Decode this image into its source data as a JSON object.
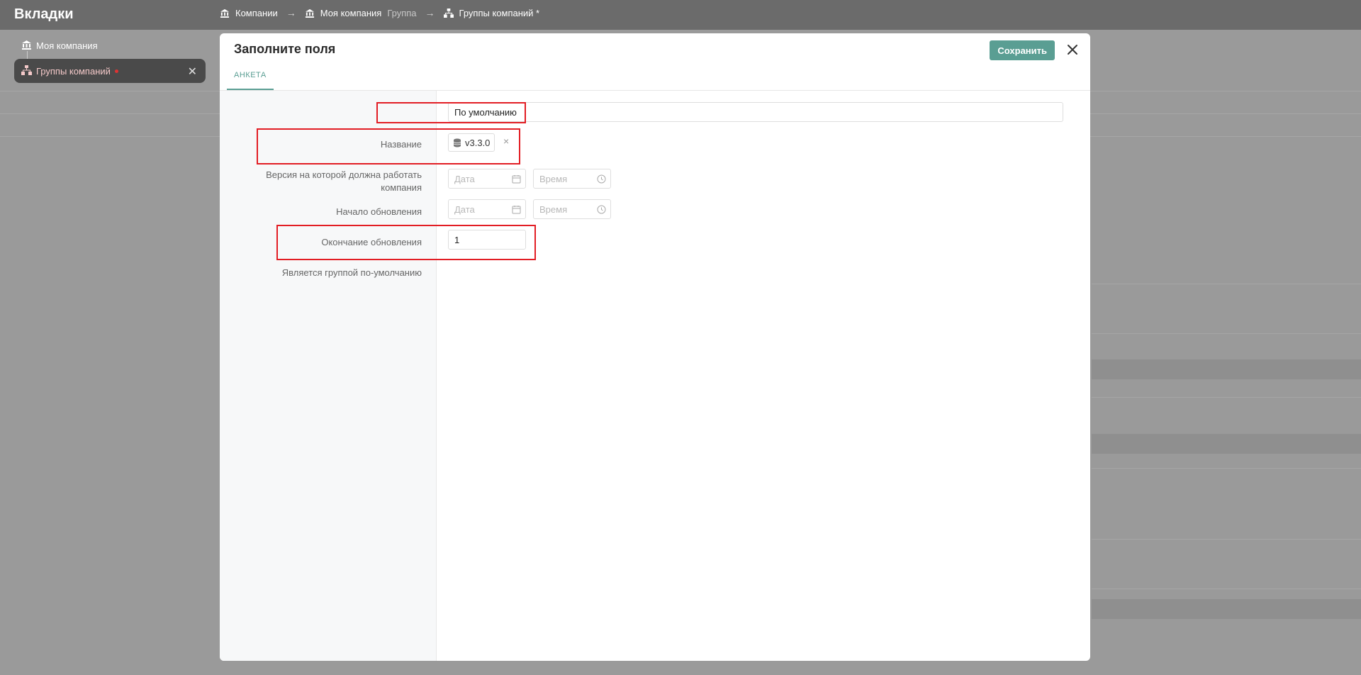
{
  "sidebar": {
    "title": "Вкладки",
    "tabs": [
      {
        "label": "Моя компания"
      },
      {
        "label": "Группы компаний"
      }
    ]
  },
  "breadcrumb": {
    "items": [
      {
        "label": "Компании",
        "suffix": ""
      },
      {
        "label": "Моя компания",
        "suffix": "Группа"
      },
      {
        "label": "Группы компаний *",
        "suffix": ""
      }
    ],
    "separator": "→"
  },
  "modal": {
    "title": "Заполните поля",
    "save_label": "Сохранить",
    "tab_label": "АНКЕТА",
    "fields": {
      "name": {
        "label": "Название",
        "value": "По умолчанию"
      },
      "version": {
        "label_line1": "Версия на которой должна работать",
        "label_line2": "компания",
        "chip": "v3.3.0",
        "remove": "×"
      },
      "update_start": {
        "label": "Начало обновления",
        "date_placeholder": "Дата",
        "time_placeholder": "Время"
      },
      "update_end": {
        "label": "Окончание обновления",
        "date_placeholder": "Дата",
        "time_placeholder": "Время"
      },
      "is_default": {
        "label": "Является группой по-умолчанию",
        "value": "1"
      }
    }
  },
  "colors": {
    "accent": "#5a9e93",
    "highlight": "#e21d24"
  }
}
